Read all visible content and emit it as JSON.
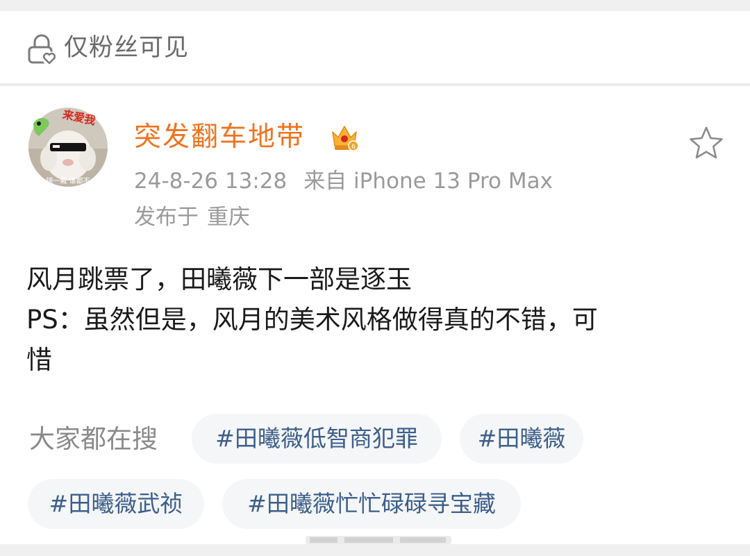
{
  "visibility": {
    "label": "仅粉丝可见",
    "icon": "lock-heart-icon"
  },
  "post": {
    "author": "突发翻车地带",
    "author_color": "#f0731f",
    "badge_icon": "crown-icon",
    "timestamp": "24-8-26 13:28",
    "source": "来自 iPhone 13 Pro Max",
    "location_prefix": "发布于",
    "location": "重庆",
    "body_lines": [
      "风月跳票了，田曦薇下一部是逐玉",
      "PS：虽然但是，风月的美术风格做得真的不错，可",
      "惜"
    ]
  },
  "search": {
    "label": "大家都在搜",
    "chips": [
      "#田曦薇低智商犯罪",
      "#田曦薇",
      "#田曦薇武祯",
      "#田曦薇忙忙碌碌寻宝藏"
    ],
    "chip_text_color": "#3d5e8a"
  },
  "avatar": {
    "badge_text": "来爱我",
    "caption": "镜一戴 谁都不"
  }
}
